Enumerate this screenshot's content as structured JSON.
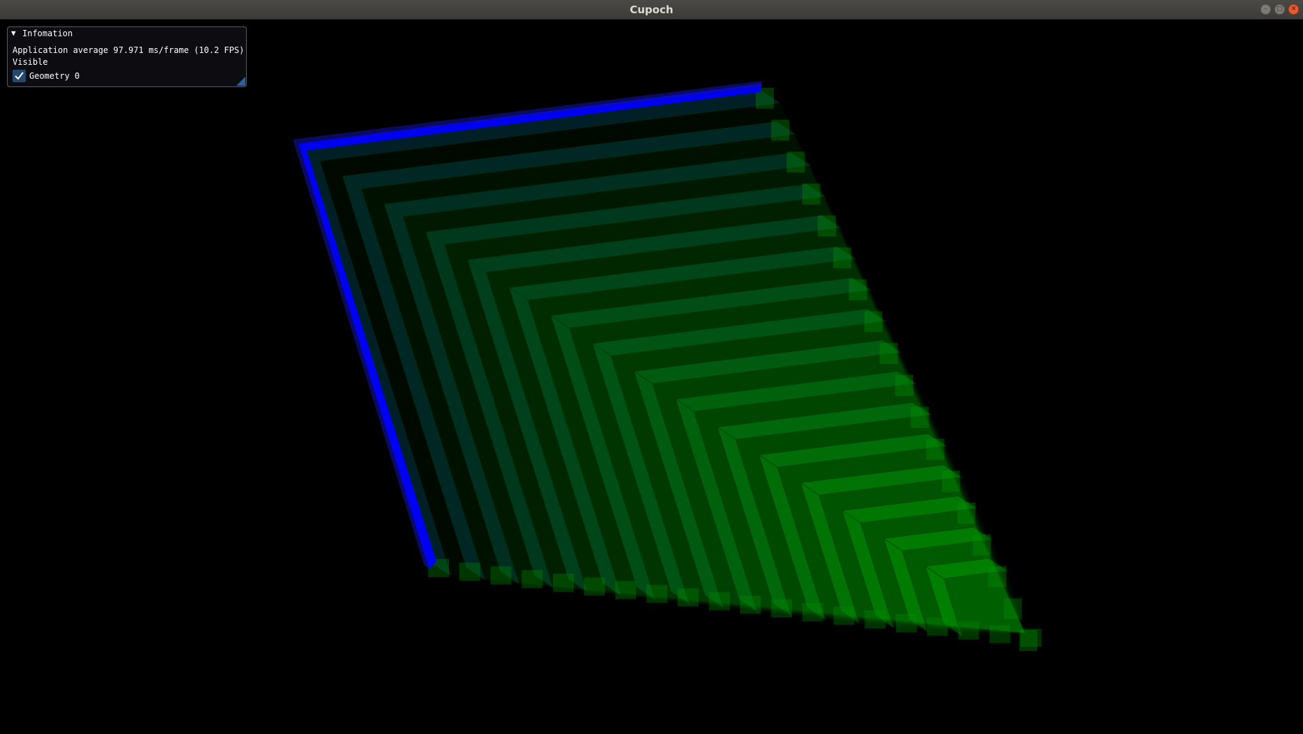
{
  "window": {
    "title": "Cupoch",
    "buttons": [
      "minimize-icon",
      "maximize-icon",
      "close-icon"
    ]
  },
  "panel": {
    "header": "Infomation",
    "fps_line": "Application average 97.971 ms/frame (10.2 FPS)",
    "visible_label": "Visible",
    "geometry_label": "Geometry 0",
    "geometry_checked": true
  },
  "colors": {
    "background": "#000000",
    "voxel_blue": "#0000ff",
    "voxel_green": "#00c800",
    "checkbox_fill": "#26486f"
  }
}
